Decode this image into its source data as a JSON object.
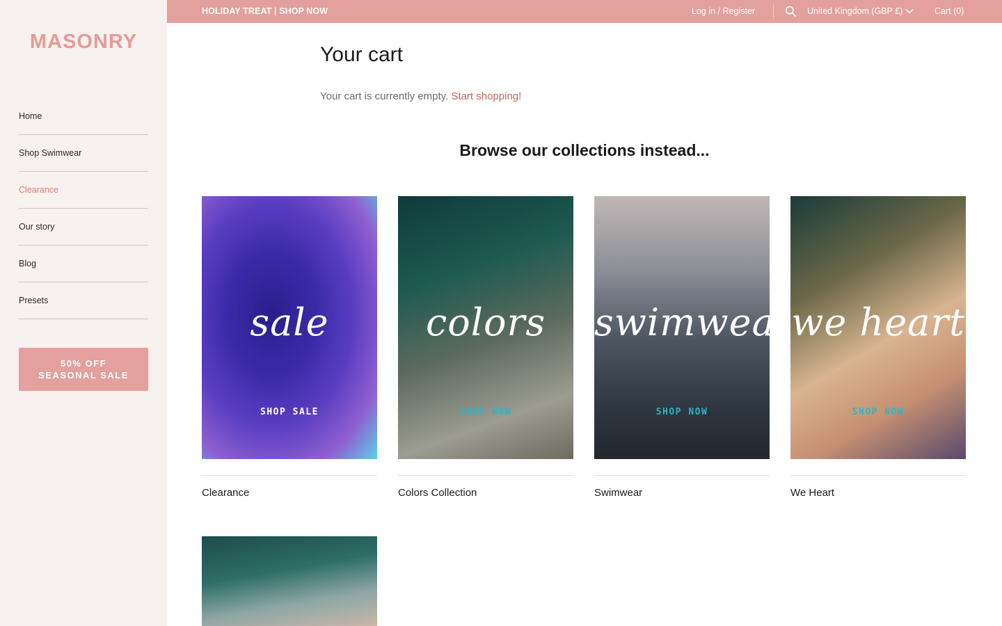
{
  "sidebar": {
    "logo": "MASONRY",
    "nav": [
      {
        "label": "Home"
      },
      {
        "label": "Shop Swimwear"
      },
      {
        "label": "Clearance"
      },
      {
        "label": "Our story"
      },
      {
        "label": "Blog"
      },
      {
        "label": "Presets"
      }
    ],
    "active_item": "Clearance",
    "sale_button": {
      "line1": "50% OFF",
      "line2": "SEASONAL SALE"
    }
  },
  "topbar": {
    "promo": "HOLIDAY TREAT | SHOP NOW",
    "login": "Log in",
    "separator": " / ",
    "register": "Register",
    "search_icon": "search-icon",
    "country": "United Kingdom (GBP £)",
    "cart": "Cart (0)"
  },
  "main": {
    "title": "Your cart",
    "empty_text": "Your cart is currently empty.",
    "start_link": "Start shopping!",
    "browse_heading": "Browse our collections instead...",
    "collections": [
      {
        "script": "sale",
        "cta": "SHOP SALE",
        "label": "Clearance"
      },
      {
        "script": "colors",
        "cta": "SHOP NOW",
        "label": "Colors Collection"
      },
      {
        "script": "swimwear",
        "cta": "SHOP NOW",
        "label": "Swimwear"
      },
      {
        "script": "we heart",
        "cta": "SHOP NOW",
        "label": "We Heart"
      },
      {
        "script": "",
        "cta": "",
        "label": ""
      }
    ]
  },
  "colors": {
    "accent": "#e3a09c",
    "logo": "#e69a96",
    "link": "#c8645c",
    "sidebar_bg": "#f7f1ef",
    "cta_white": "#ffffff",
    "cta_teal": "#2bb6c4"
  }
}
